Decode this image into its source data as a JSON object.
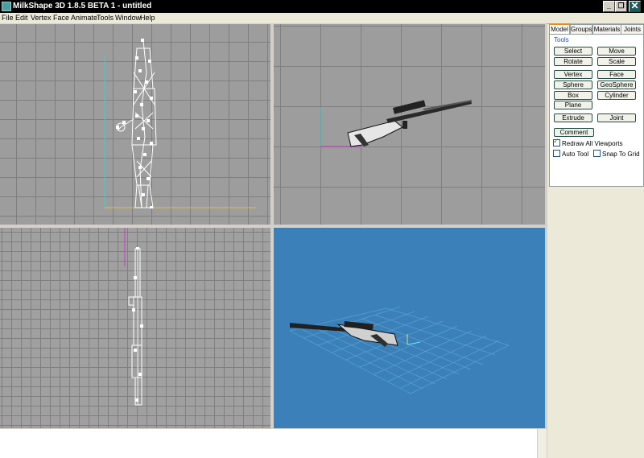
{
  "window": {
    "title": "MilkShape 3D 1.8.5 BETA 1 - untitled",
    "minimize": "_",
    "restore": "❐",
    "close": "✕"
  },
  "menu": [
    "File",
    "Edit",
    "Vertex",
    "Face",
    "Animate",
    "Tools",
    "Window",
    "Help"
  ],
  "tabs": [
    "Model",
    "Groups",
    "Materials",
    "Joints"
  ],
  "active_tab": "Model",
  "tools_group_label": "Tools",
  "tool_buttons": [
    "Select",
    "Move",
    "Rotate",
    "Scale",
    "Vertex",
    "Face",
    "Sphere",
    "GeoSphere",
    "Box",
    "Cylinder",
    "Plane",
    "Extrude",
    "Joint"
  ],
  "comment_button": "Comment",
  "checkboxes": {
    "redraw_all_viewports": {
      "label": "Redraw All Viewports",
      "checked": true
    },
    "auto_tool": {
      "label": "Auto Tool",
      "checked": false
    },
    "snap_to_grid": {
      "label": "Snap To Grid",
      "checked": false
    }
  },
  "colors": {
    "viewport_gray": "#9d9d9d",
    "viewport_3d_blue": "#3b80b8",
    "axis_cyan": "#4fc6c6",
    "axis_yellow": "#e0c040",
    "axis_magenta": "#c040c0",
    "panel_bg": "#ece9d8",
    "button_border": "#1e4b41",
    "tab_accent": "#e68b2c"
  },
  "icons": [
    "app-icon",
    "minimize-icon",
    "restore-icon",
    "close-icon",
    "checkmark-icon"
  ]
}
